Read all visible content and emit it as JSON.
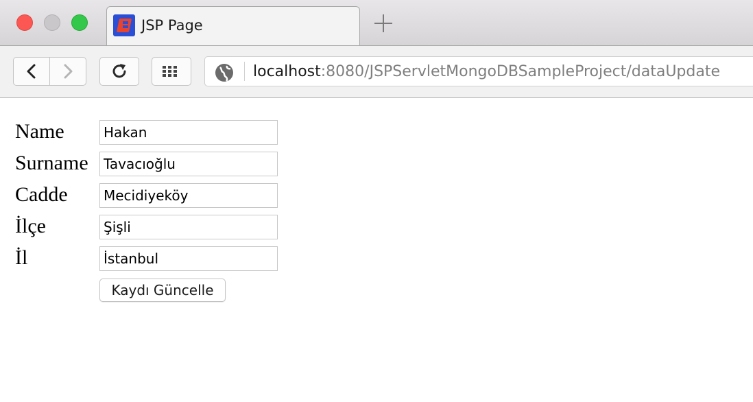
{
  "browser": {
    "tab_title": "JSP Page",
    "url_host": "localhost",
    "url_rest": ":8080/JSPServletMongoDBSampleProject/dataUpdate"
  },
  "form": {
    "fields": [
      {
        "label": "Name",
        "value": "Hakan"
      },
      {
        "label": "Surname",
        "value": "Tavacıoğlu"
      },
      {
        "label": "Cadde",
        "value": "Mecidiyeköy"
      },
      {
        "label": "İlçe",
        "value": "Şişli"
      },
      {
        "label": "İl",
        "value": "İstanbul"
      }
    ],
    "submit_label": "Kaydı Güncelle"
  }
}
